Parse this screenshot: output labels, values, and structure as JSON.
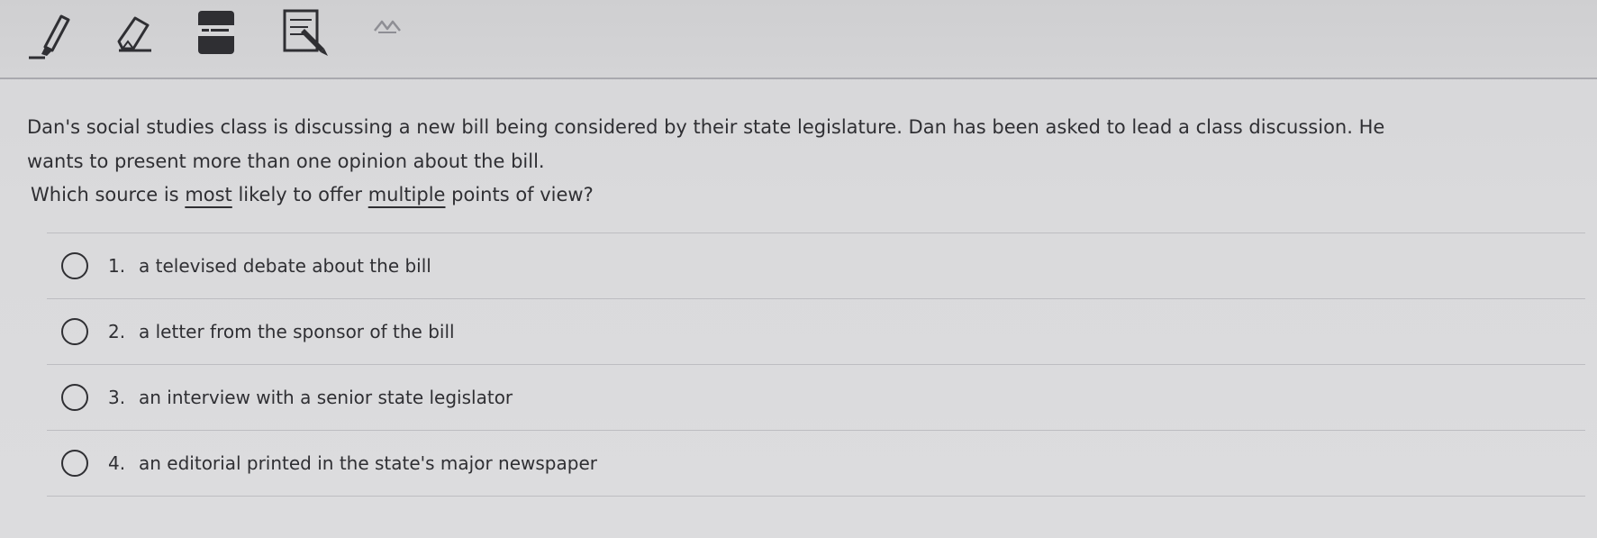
{
  "toolbar": {
    "tools": [
      {
        "name": "highlighter-icon"
      },
      {
        "name": "eraser-icon"
      },
      {
        "name": "line-reader-icon"
      },
      {
        "name": "notepad-icon"
      },
      {
        "name": "zoom-icon"
      }
    ]
  },
  "question": {
    "passage_line1": "Dan's social studies class is discussing a new bill being considered by their state legislature. Dan has been asked to lead a class discussion. He",
    "passage_line2": "wants to present more than one opinion about the bill.",
    "prompt_part1": "Which source is ",
    "prompt_emph1": "most",
    "prompt_part2": " likely to offer ",
    "prompt_emph2": "multiple",
    "prompt_part3": " points of view?",
    "choices": [
      {
        "number": "1.",
        "text": "a televised debate about the bill"
      },
      {
        "number": "2.",
        "text": "a letter from the sponsor of the bill"
      },
      {
        "number": "3.",
        "text": "an interview with a senior state legislator"
      },
      {
        "number": "4.",
        "text": "an editorial printed in the state's major newspaper"
      }
    ]
  }
}
